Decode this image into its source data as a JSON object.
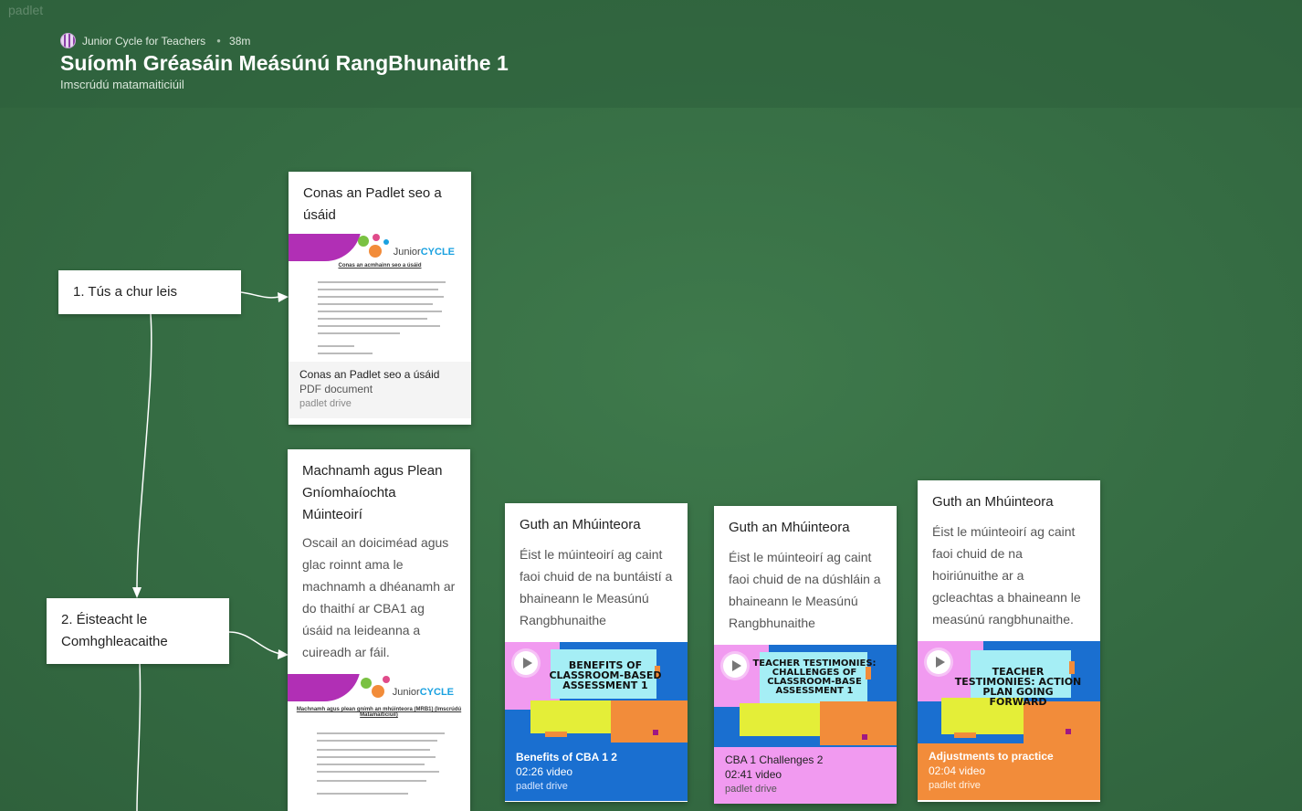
{
  "brand": "padlet",
  "header": {
    "author": "Junior Cycle for Teachers",
    "time": "38m",
    "title": "Suíomh Gréasáin Meásúnú RangBhunaithe 1",
    "subtitle": "Imscrúdú matamaiticiúil"
  },
  "sections": [
    {
      "label": "1. Tús a chur leis"
    },
    {
      "label": "2. Éisteacht le Comhghleacaithe"
    }
  ],
  "posts": {
    "how_to": {
      "title": "Conas an Padlet seo a úsáid",
      "doc_heading": "Conas an acmhainn seo a úsáid",
      "attachment": {
        "name": "Conas an Padlet seo a úsáid",
        "type": "PDF document",
        "source": "padlet drive"
      }
    },
    "reflection": {
      "title": "Machnamh agus Plean Gníomhaíochta Múinteoirí",
      "body": "Oscail an doiciméad agus glac roinnt ama le machnamh a dhéanamh ar do thaithí ar CBA1 ag úsáid na leideanna a cuireadh ar fáil.",
      "doc_heading": "Machnamh agus plean gnímh an mhúinteora (MRB1) (Imscrúdú Matamaiticiúil)"
    },
    "video1": {
      "title": "Guth an Mhúinteora",
      "body": "Éist le múinteoirí ag caint faoi chuid de na buntáistí a bhaineann le Measúnú Rangbhunaithe",
      "thumb_text": "Benefits of Classroom-Based Assessment 1",
      "attachment": {
        "name": "Benefits of CBA 1 2",
        "type": "02:26 video",
        "source": "padlet drive"
      }
    },
    "video2": {
      "title": "Guth an Mhúinteora",
      "body": "Éist le múinteoirí ag caint faoi chuid de na dúshláin a bhaineann le Measúnú Rangbhunaithe",
      "thumb_text": "Teacher Testimonies: Challenges of Classroom-Base Assessment 1",
      "attachment": {
        "name": "CBA 1 Challenges 2",
        "type": "02:41 video",
        "source": "padlet drive"
      }
    },
    "video3": {
      "title": "Guth an Mhúinteora",
      "body": "Éist le múinteoirí ag caint faoi chuid de na hoiriúnuithe ar a gcleachtas a bhaineann le measúnú rangbhunaithe.",
      "thumb_text": "Teacher Testimonies: Action Plan Going Forward",
      "attachment": {
        "name": "Adjustments to practice",
        "type": "02:04 video",
        "source": "padlet drive"
      }
    }
  },
  "colors": {
    "background": "#376d45",
    "video_blue": "#1a6fd0",
    "video_pink": "#f19af0",
    "video_orange": "#f28c3a"
  }
}
